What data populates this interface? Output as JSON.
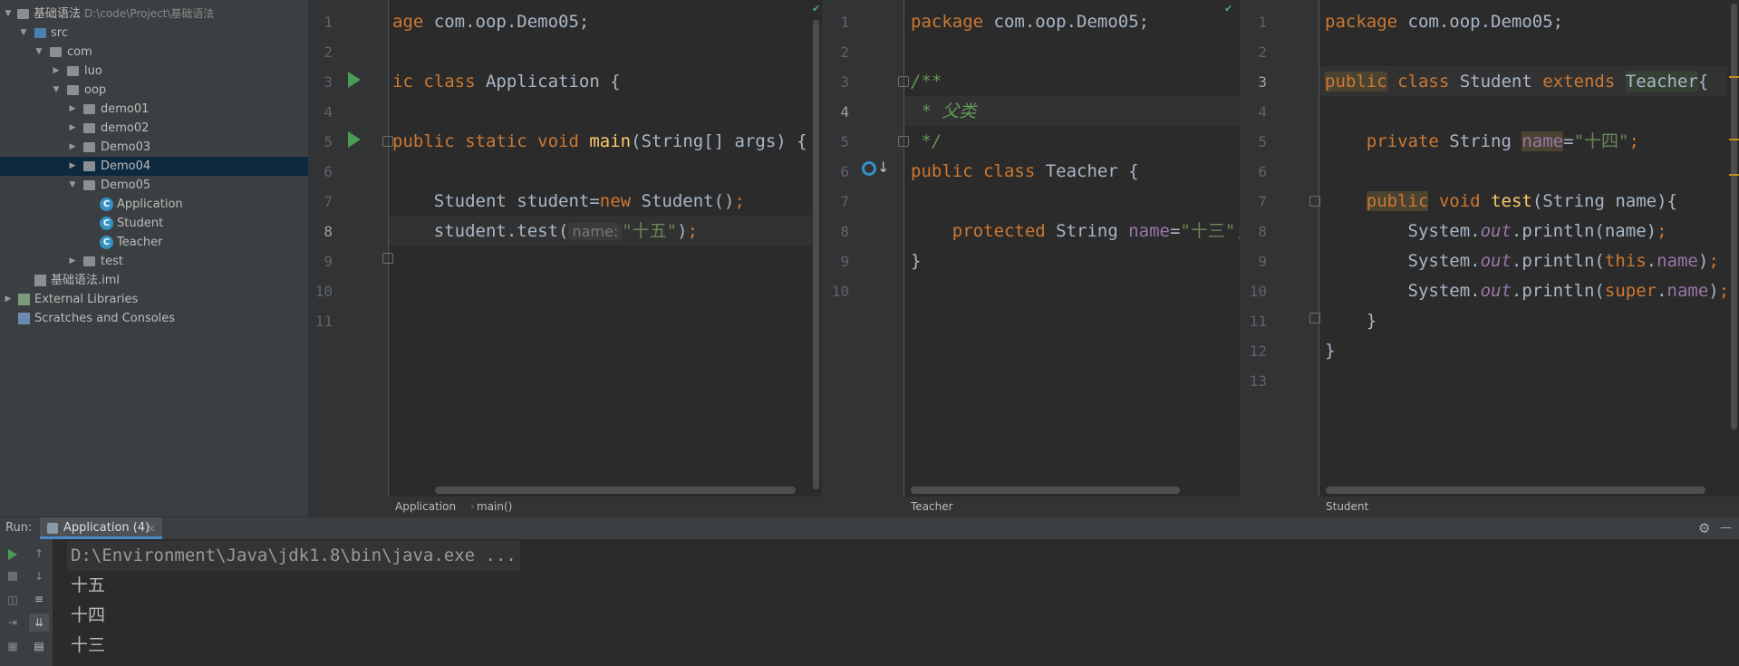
{
  "project": {
    "root_name": "基础语法",
    "root_path": "D:\\code\\Project\\基础语法",
    "items": [
      {
        "label": "src"
      },
      {
        "label": "com"
      },
      {
        "label": "luo"
      },
      {
        "label": "oop"
      },
      {
        "label": "demo01"
      },
      {
        "label": "demo02"
      },
      {
        "label": "Demo03"
      },
      {
        "label": "Demo04"
      },
      {
        "label": "Demo05"
      },
      {
        "label": "Application"
      },
      {
        "label": "Student"
      },
      {
        "label": "Teacher"
      },
      {
        "label": "test"
      },
      {
        "label": "基础语法.iml"
      },
      {
        "label": "External Libraries"
      },
      {
        "label": "Scratches and Consoles"
      }
    ]
  },
  "editors": [
    {
      "breadcrumb": "Application",
      "breadcrumb_method": "main()",
      "line_numbers": [
        "1",
        "2",
        "3",
        "4",
        "5",
        "6",
        "7",
        "8",
        "9",
        "10",
        "11"
      ],
      "code": {
        "l1_kw": "age",
        "l1_rest": " com.oop.Demo05;",
        "l3_kw": "ic class",
        "l3_rest": " Application {",
        "l5_kw": "public static void",
        "l5_fn": "main",
        "l5_rest": "(String[] args) {",
        "l7_a": "    Student student=",
        "l7_kw": "new",
        "l7_b": " Student()",
        "l7_semi": ";",
        "l8_a": "    student.test(",
        "l8_hint": "name:",
        "l8_str": "\"十五\"",
        "l8_b": ")",
        "l8_semi": ";"
      }
    },
    {
      "breadcrumb": "Teacher",
      "line_numbers": [
        "1",
        "2",
        "3",
        "4",
        "5",
        "6",
        "7",
        "8",
        "9",
        "10"
      ],
      "code": {
        "l1_kw": "package",
        "l1_rest": " com.oop.Demo05;",
        "l3": "/**",
        "l4": " * 父类",
        "l5": " */",
        "l6_kw": "public class",
        "l6_rest": " Teacher {",
        "l8_kw": "    protected",
        "l8_a": " String ",
        "l8_fld": "name",
        "l8_eq": "=",
        "l8_str": "\"十三\"",
        "l8_semi": ";",
        "l9": "}"
      }
    },
    {
      "breadcrumb": "Student",
      "line_numbers": [
        "1",
        "2",
        "3",
        "4",
        "5",
        "6",
        "7",
        "8",
        "9",
        "10",
        "11",
        "12",
        "13"
      ],
      "code": {
        "l1_kw": "package",
        "l1_rest": " com.oop.Demo05;",
        "l3_kw1": "public",
        "l3_kw2": " class",
        "l3_a": " Student ",
        "l3_kw3": "extends",
        "l3_sp": " ",
        "l3_b": "Teacher",
        "l3_c": "{",
        "l5_kw": "    private",
        "l5_a": " String ",
        "l5_fld": "name",
        "l5_eq": "=",
        "l5_str": "\"十四\"",
        "l5_semi": ";",
        "l7_ind": "    ",
        "l7_kw1": "public",
        "l7_kw2": " void",
        "l7_sp": " ",
        "l7_fn": "test",
        "l7_rest": "(String name){",
        "l8_a": "        System.",
        "l8_st": "out",
        "l8_b": ".println(name)",
        "l8_semi": ";",
        "l9_a": "        System.",
        "l9_st": "out",
        "l9_b": ".println(",
        "l9_kw": "this",
        "l9_c": ".",
        "l9_fld": "name",
        "l9_d": ")",
        "l9_semi": ";",
        "l10_a": "        System.",
        "l10_st": "out",
        "l10_b": ".println(",
        "l10_kw": "super",
        "l10_c": ".",
        "l10_fld": "name",
        "l10_d": ")",
        "l10_semi": ";",
        "l11": "    }",
        "l12": "}"
      }
    }
  ],
  "run": {
    "label": "Run:",
    "tab_label": "Application (4)",
    "close": "×",
    "settings": "⚙",
    "minimize": "—",
    "output": [
      "D:\\Environment\\Java\\jdk1.8\\bin\\java.exe ...",
      "十五",
      "十四",
      "十三"
    ]
  },
  "icons": {
    "class_glyph": "C",
    "expanded": "▼",
    "collapsed": "▶"
  },
  "colors": {
    "keyword": "#cc7832",
    "function": "#ffc66d",
    "string": "#6a8759",
    "field": "#9876aa",
    "comment": "#629755",
    "run_green": "#499c54"
  }
}
